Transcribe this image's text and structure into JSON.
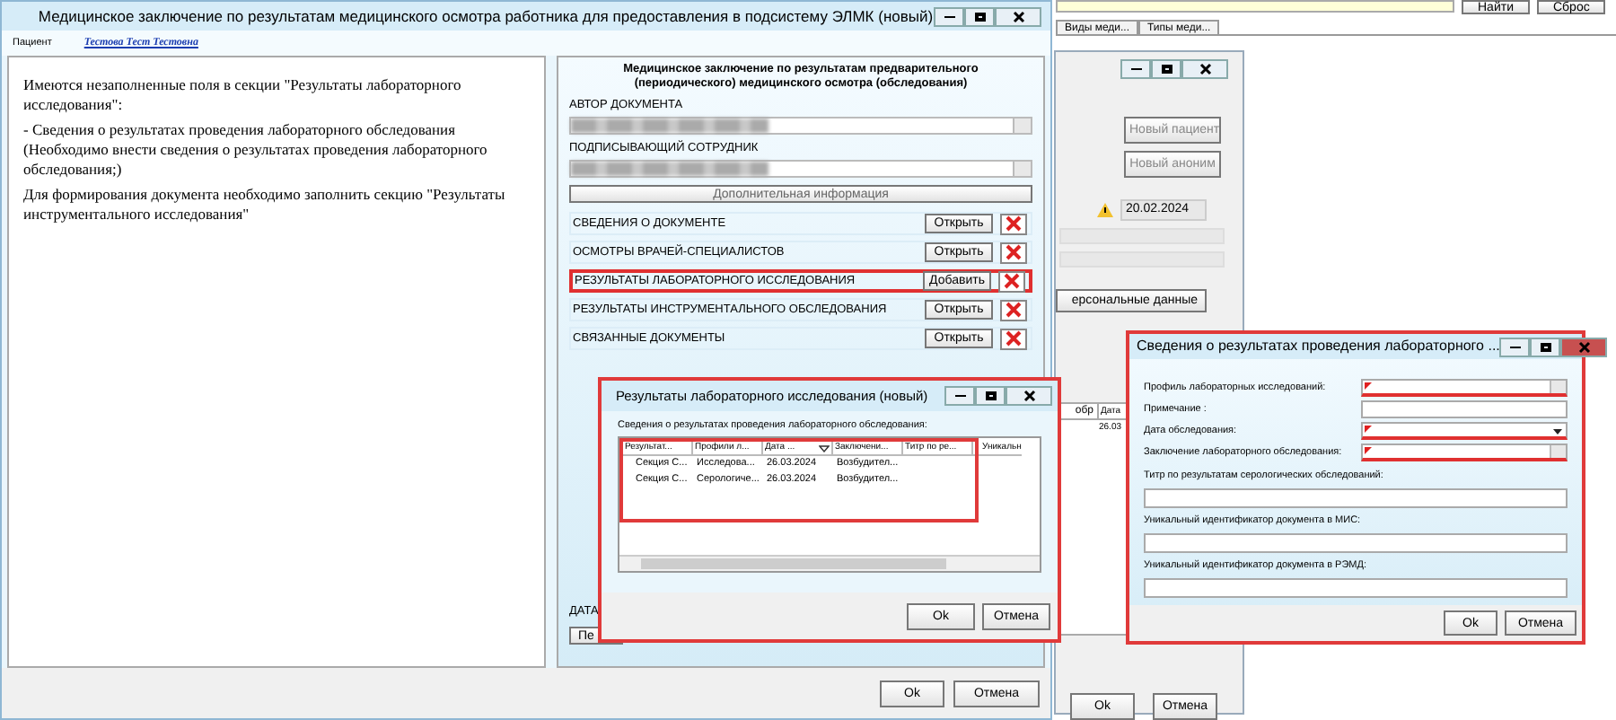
{
  "background_app": {
    "search_buttons": [
      "Найти",
      "Сброс"
    ],
    "tabs": [
      {
        "label": "Виды меди...",
        "selected": false
      },
      {
        "label": "Типы меди...",
        "selected": false
      }
    ],
    "window": {
      "patient_buttons": [
        "Новый пациент",
        "Новый аноним"
      ],
      "date": "20.02.2024",
      "personal_button": "ерсональные данные",
      "table": {
        "columns": [
          "обр",
          "Дата"
        ],
        "rows": [
          [
            "",
            "26.03"
          ]
        ]
      },
      "buttons": [
        "Ok",
        "Отмена"
      ]
    }
  },
  "main_window": {
    "title": "Медицинское заключение по результатам медицинского осмотра работника для предоставления в подсистему ЭЛМК (новый)",
    "patient_label": "Пациент",
    "patient_name": "Тестова Тест Тестовна",
    "messages": [
      "Имеются незаполненные поля в секции \"Результаты лабораторного исследования\":",
      "- Сведения о результатах проведения лабораторного обследования (Необходимо внести сведения о результатах проведения лабораторного обследования;)",
      "Для формирования документа необходимо заполнить секцию \"Результаты инструментального исследования\""
    ],
    "form": {
      "heading": "Медицинское заключение по результатам предварительного (периодического) медицинского осмотра (обследования)",
      "fields": [
        {
          "label": "АВТОР ДОКУМЕНТА"
        },
        {
          "label": "ПОДПИСЫВАЮЩИЙ СОТРУДНИК"
        }
      ],
      "extra_button": "Дополнительная информация",
      "sections": [
        {
          "label": "СВЕДЕНИЯ О ДОКУМЕНТЕ",
          "action": "Открыть",
          "highlighted": false
        },
        {
          "label": "ОСМОТРЫ ВРАЧЕЙ-СПЕЦИАЛИСТОВ",
          "action": "Открыть",
          "highlighted": false
        },
        {
          "label": "РЕЗУЛЬТАТЫ ЛАБОРАТОРНОГО ИССЛЕДОВАНИЯ",
          "action": "Добавить",
          "highlighted": true
        },
        {
          "label": "РЕЗУЛЬТАТЫ ИНСТРУМЕНТАЛЬНОГО ОБСЛЕДОВАНИЯ",
          "action": "Открыть",
          "highlighted": false
        },
        {
          "label": "СВЯЗАННЫЕ ДОКУМЕНТЫ",
          "action": "Открыть",
          "highlighted": false
        }
      ],
      "date_label": "ДАТА",
      "date_button": "Пе"
    },
    "buttons": [
      "Ok",
      "Отмена"
    ]
  },
  "results_dialog": {
    "title": "Результаты лабораторного исследования (новый)",
    "caption": "Сведения о результатах проведения лабораторного обследования:",
    "table": {
      "columns": [
        "Результат...",
        "Профили л...",
        "Дата ...",
        "Заключени...",
        "Титр по ре...",
        "Уникальн"
      ],
      "rows": [
        [
          "Секция С...",
          "Исследова...",
          "26.03.2024",
          "Возбудител...",
          ""
        ],
        [
          "Секция С...",
          "Серологиче...",
          "26.03.2024",
          "Возбудител...",
          ""
        ]
      ]
    },
    "buttons": [
      "Ok",
      "Отмена"
    ]
  },
  "details_dialog": {
    "title": "Сведения о результатах проведения лабораторного ...",
    "fields": [
      {
        "label": "Профиль лабораторных исследований:",
        "kind": "lookup",
        "required": true
      },
      {
        "label": "Примечание :",
        "kind": "text",
        "required": false
      },
      {
        "label": "Дата обследования:",
        "kind": "dropdown",
        "required": true
      },
      {
        "label": "Заключение лабораторного обследования:",
        "kind": "lookup",
        "required": true
      },
      {
        "label": "Титр по результатам серологических обследований:",
        "kind": "stacked",
        "required": false
      },
      {
        "label": "Уникальный идентификатор документа в МИС:",
        "kind": "stacked",
        "required": false
      },
      {
        "label": "Уникальный идентификатор документа в РЭМД:",
        "kind": "stacked",
        "required": false
      }
    ],
    "buttons": [
      "Ok",
      "Отмена"
    ]
  }
}
